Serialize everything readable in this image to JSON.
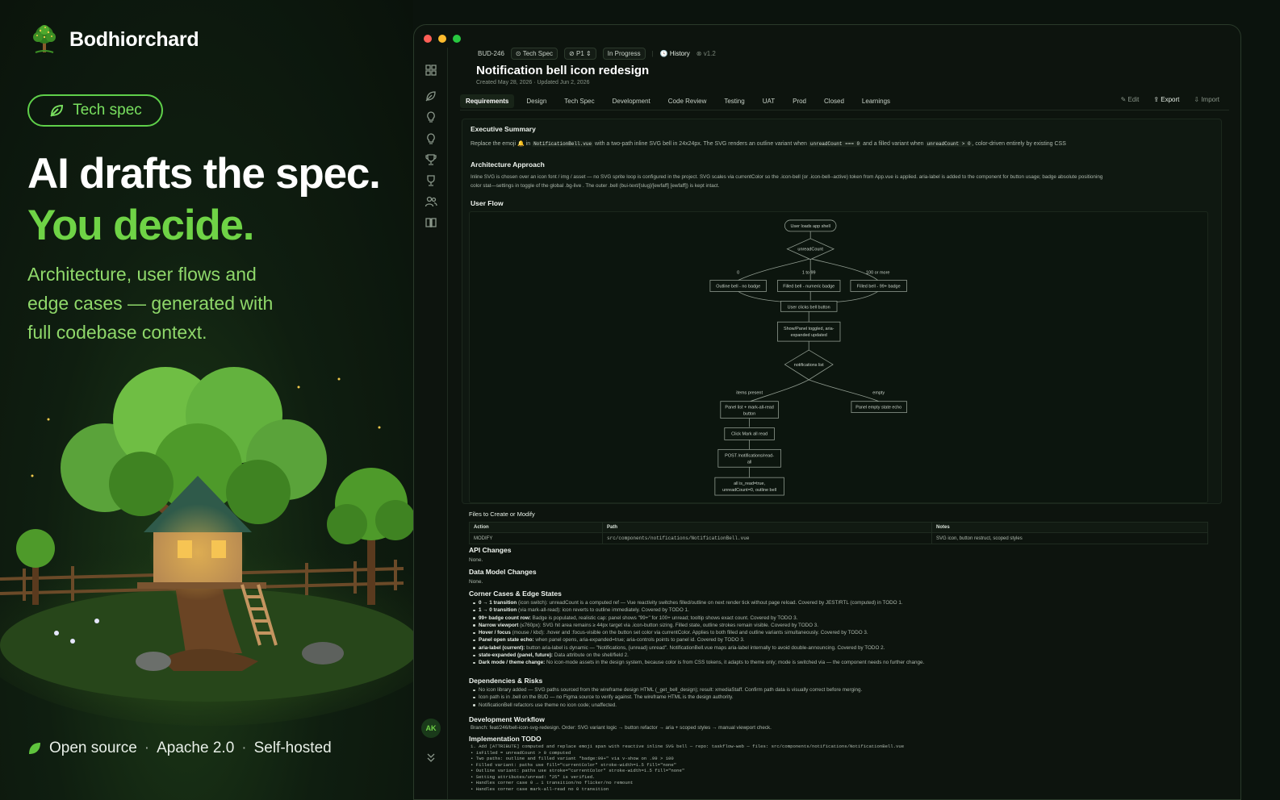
{
  "brand": {
    "name": "Bodhiorchard"
  },
  "hero": {
    "pill": "Tech spec",
    "headline_1": "AI drafts the spec.",
    "headline_2": "You decide.",
    "subtitle_lines": [
      "Architecture, user flows and",
      "edge cases — generated with",
      "full codebase context."
    ],
    "footer": {
      "items": [
        "Open source",
        "Apache 2.0",
        "Self-hosted"
      ],
      "sep": "·"
    }
  },
  "colors": {
    "accent": "#6fd346",
    "bg": "#0b130d",
    "panel": "#0f1811"
  },
  "app": {
    "breadcrumb": {
      "id": "BUD-246",
      "type": "Tech Spec",
      "priority": "P1",
      "status": "In Progress",
      "history": "History",
      "version": "v1.2"
    },
    "title": "Notification bell icon redesign",
    "meta": "Created May 28, 2026 · Updated Jun 2, 2026",
    "tabs": [
      "Requirements",
      "Design",
      "Tech Spec",
      "Development",
      "Code Review",
      "Testing",
      "UAT",
      "Prod",
      "Closed",
      "Learnings"
    ],
    "actions": {
      "edit": "Edit",
      "export": "Export",
      "import": "Import"
    },
    "avatar": "AK",
    "doc": {
      "exec_title": "Executive Summary",
      "exec_a": "Replace the emoji",
      "exec_b": "in",
      "exec_code1": "NotificationBell.vue",
      "exec_c": "with a two-path inline SVG bell in 24x24px. The SVG renders an outline variant when",
      "exec_code2": "unreadCount === 0",
      "exec_d": "and a filled variant when",
      "exec_code3": "unreadCount > 0",
      "exec_e": ", color-driven entirely by existing CSS",
      "arch_title": "Architecture Approach",
      "arch_l1": "Inline SVG is chosen over an icon font / img / asset — no SVG sprite loop is configured in the project. SVG scales via currentColor so the .icon-bell (or .icon-bell--active) token from App.vue is applied. aria-label is added to the component for button usage; badge absolute positioning",
      "arch_l2": "color stat—settings in toggle of the global .bg-live . The outer .bell (bui-text/[slug]/[ewfaff] [ewfaff]) is kept intact.",
      "userflow_title": "User Flow",
      "flow": {
        "n1": "User loads app shell",
        "d1": "unreadCount",
        "l0": "0",
        "l1": "1 to 99",
        "l2": "100 or more",
        "b0": "Outline bell - no badge",
        "b1": "Filled bell - numeric badge",
        "b2": "Filled bell - 99+ badge",
        "n2": "User clicks bell button",
        "n3a": "Show/Panel toggled, aria-",
        "n3b": "expanded updated",
        "d2": "notifications list",
        "l3": "items present",
        "l4": "empty",
        "e1a": "Panel list + mark-all-read",
        "e1b": "button",
        "e2": "Panel empty state echo",
        "n4": "Click Mark all read",
        "n5a": "POST /notifications/read-",
        "n5b": "all",
        "n6a": "all is_read=true,",
        "n6b": "unreadCount=0, outline bell"
      },
      "files_title": "Files to Create or Modify",
      "files_headers": [
        "Action",
        "Path",
        "Notes"
      ],
      "files_row": [
        "MODIFY",
        "src/components/notifications/NotificationBell.vue",
        "SVG icon, button restruct, scoped styles"
      ],
      "api_title": "API Changes",
      "api_val": "None.",
      "dm_title": "Data Model Changes",
      "dm_val": "None.",
      "corner_title": "Corner Cases & Edge States",
      "corner": [
        {
          "b": "0 → 1 transition",
          "t": " (icon switch): unreadCount is a computed ref — Vue reactivity switches filled/outline on next render tick without page reload. Covered by JEST/RTL (computed) in TODO 1."
        },
        {
          "b": "1 → 0 transition",
          "t": " (via mark-all-read): icon reverts to outline immediately. Covered by TODO 1."
        },
        {
          "b": "99+ badge count row:",
          "t": " Badge is populated, realistic cap: panel shows \"99+\" for 100+ unread; tooltip shows exact count. Covered by TODO 3."
        },
        {
          "b": "Narrow viewport",
          "t": " (≤760px): SVG hit area remains ≥ 44px target via .icon-button sizing. Filled state, outline strokes remain visible. Covered by TODO 3."
        },
        {
          "b": "Hover / focus",
          "t": " (mouse / kbd): .hover and :focus-visible on the button set color via currentColor. Applies to both filled and outline variants simultaneously. Covered by TODO 3."
        },
        {
          "b": "Panel open state echo:",
          "t": " when panel opens, aria-expanded=true; aria-controls points to panel id. Covered by TODO 3."
        },
        {
          "b": "aria-label (current):",
          "t": " button aria-label is dynamic — \"Notifications, {unread} unread\". NotificationBell.vue maps aria-label internally to avoid double-announcing. Covered by TODO 2."
        },
        {
          "b": "state-expanded (panel, future):",
          "t": " Data attribute on the shell/field 2."
        },
        {
          "b": "Dark mode / theme change:",
          "t": " No icon-mode assets in the design system, because color is from CSS tokens, it adapts to theme only; mode is switched via — the component needs no further change."
        }
      ],
      "deps_title": "Dependencies & Risks",
      "deps": [
        "No icon library added — SVG paths sourced from the wireframe design HTML (_get_bell_design); result: xmediaStaff. Confirm path data is visually correct before merging.",
        "Icon path is in .bell on the BUD — no Figma source to verify against. The wireframe HTML is the design authority.",
        "NotificationBell refactors use theme no icon code; unaffected."
      ],
      "dw_title": "Development Workflow",
      "dw_val": "Branch: feat/246/bell-icon-svg-redesign. Order: SVG variant logic → button refactor → aria + scoped styles → manual viewport check.",
      "impl_title": "Implementation TODO",
      "impl": [
        "1. Add [ATTRIBUTE] computed and replace emoji span with reactive inline SVG bell — repo: taskflow-web — files: src/components/notifications/NotificationBell.vue",
        "   • isFilled = unreadCount > 0 computed",
        "   • Two paths: outline and filled variant \"badge:99+\" via v-show on .99 > 100",
        "   • Filled variant: paths use fill=\"currentColor\" stroke-width=1.5 fill=\"none\"",
        "   • Outline variant: paths use stroke=\"currentColor\" stroke-width=1.5 fill=\"none\"",
        "   • Setting attributes/unread: \"25\" is verified.",
        "   • Handles corner case 0 → 1 transition/no flicker/no remount",
        "   • Handles corner case mark-all-read no 0 transition"
      ]
    }
  }
}
